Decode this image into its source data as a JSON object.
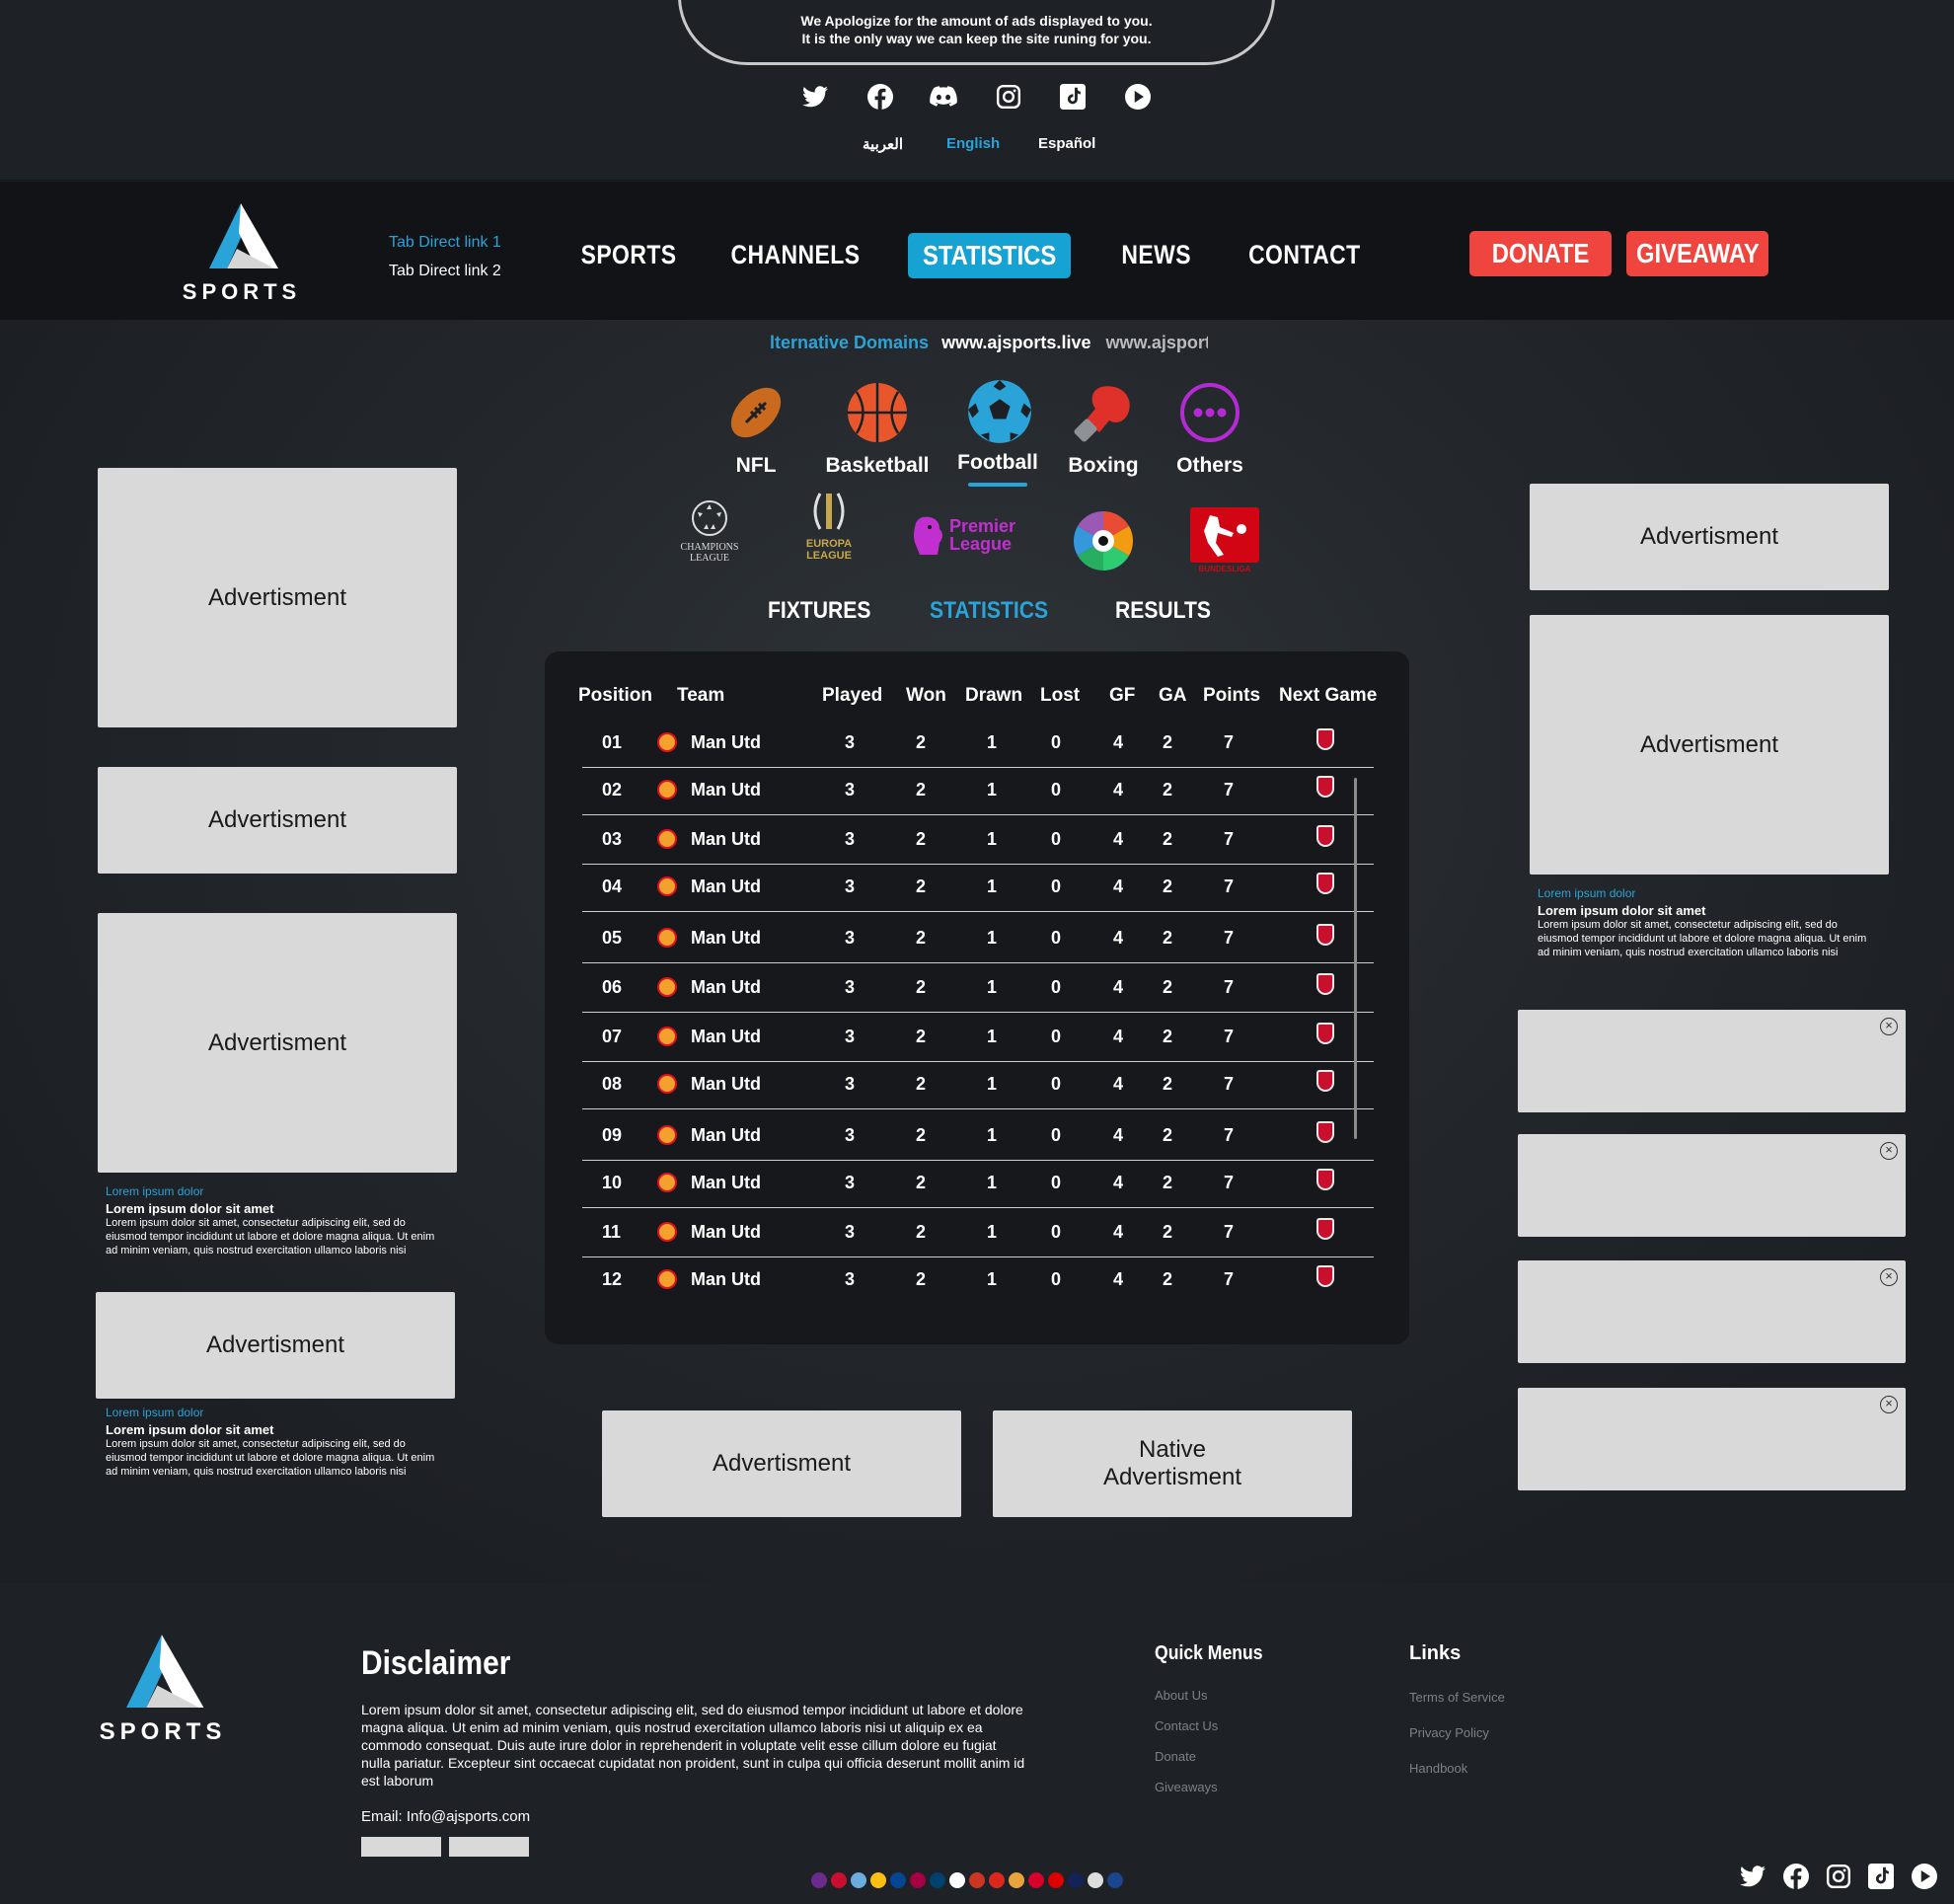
{
  "notice": {
    "line1": "We Apologize for the amount of ads displayed to you.",
    "line2": "It is the only way we can keep the site runing for you."
  },
  "social_icons": [
    "twitter-icon",
    "facebook-icon",
    "discord-icon",
    "instagram-icon",
    "tiktok-icon",
    "play-icon"
  ],
  "languages": {
    "arabic": "العربية",
    "english": "English",
    "spanish": "Español"
  },
  "logo": {
    "text": "SPORTS"
  },
  "tab_links": {
    "link1": "Tab Direct link 1",
    "link2": "Tab Direct link 2"
  },
  "nav": {
    "sports": "SPORTS",
    "channels": "CHANNELS",
    "statistics": "STATISTICS",
    "news": "NEWS",
    "contact": "CONTACT"
  },
  "buttons": {
    "donate": "DONATE",
    "giveaway": "GIVEAWAY"
  },
  "domains": {
    "label": "lternative Domains",
    "d1": "www.ajsports.live",
    "d2": "www.ajsports.liv"
  },
  "sports": [
    {
      "label": "NFL",
      "icon": "football-nfl-icon",
      "color": "#c96a1e"
    },
    {
      "label": "Basketball",
      "icon": "basketball-icon",
      "color": "#e8572c"
    },
    {
      "label": "Football",
      "icon": "soccer-ball-icon",
      "color": "#2aa3d8"
    },
    {
      "label": "Boxing",
      "icon": "boxing-glove-icon",
      "color": "#e0302a"
    },
    {
      "label": "Others",
      "icon": "more-icon",
      "color": "#b62ad6"
    }
  ],
  "leagues": {
    "ucl": "CHAMPIONS LEAGUE",
    "uel": "EUROPA LEAGUE",
    "pl": "Premier League",
    "bundesliga": "BUNDESLIGA"
  },
  "tabs": {
    "fixtures": "FIXTURES",
    "statistics": "STATISTICS",
    "results": "RESULTS"
  },
  "table": {
    "headers": {
      "position": "Position",
      "team": "Team",
      "played": "Played",
      "won": "Won",
      "drawn": "Drawn",
      "lost": "Lost",
      "gf": "GF",
      "ga": "GA",
      "points": "Points",
      "next": "Next Game"
    },
    "rows": [
      {
        "pos": "01",
        "team": "Man Utd",
        "played": "3",
        "won": "2",
        "drawn": "1",
        "lost": "0",
        "gf": "4",
        "ga": "2",
        "points": "7"
      },
      {
        "pos": "02",
        "team": "Man Utd",
        "played": "3",
        "won": "2",
        "drawn": "1",
        "lost": "0",
        "gf": "4",
        "ga": "2",
        "points": "7"
      },
      {
        "pos": "03",
        "team": "Man Utd",
        "played": "3",
        "won": "2",
        "drawn": "1",
        "lost": "0",
        "gf": "4",
        "ga": "2",
        "points": "7"
      },
      {
        "pos": "04",
        "team": "Man Utd",
        "played": "3",
        "won": "2",
        "drawn": "1",
        "lost": "0",
        "gf": "4",
        "ga": "2",
        "points": "7"
      },
      {
        "pos": "05",
        "team": "Man Utd",
        "played": "3",
        "won": "2",
        "drawn": "1",
        "lost": "0",
        "gf": "4",
        "ga": "2",
        "points": "7"
      },
      {
        "pos": "06",
        "team": "Man Utd",
        "played": "3",
        "won": "2",
        "drawn": "1",
        "lost": "0",
        "gf": "4",
        "ga": "2",
        "points": "7"
      },
      {
        "pos": "07",
        "team": "Man Utd",
        "played": "3",
        "won": "2",
        "drawn": "1",
        "lost": "0",
        "gf": "4",
        "ga": "2",
        "points": "7"
      },
      {
        "pos": "08",
        "team": "Man Utd",
        "played": "3",
        "won": "2",
        "drawn": "1",
        "lost": "0",
        "gf": "4",
        "ga": "2",
        "points": "7"
      },
      {
        "pos": "09",
        "team": "Man Utd",
        "played": "3",
        "won": "2",
        "drawn": "1",
        "lost": "0",
        "gf": "4",
        "ga": "2",
        "points": "7"
      },
      {
        "pos": "10",
        "team": "Man Utd",
        "played": "3",
        "won": "2",
        "drawn": "1",
        "lost": "0",
        "gf": "4",
        "ga": "2",
        "points": "7"
      },
      {
        "pos": "11",
        "team": "Man Utd",
        "played": "3",
        "won": "2",
        "drawn": "1",
        "lost": "0",
        "gf": "4",
        "ga": "2",
        "points": "7"
      },
      {
        "pos": "12",
        "team": "Man Utd",
        "played": "3",
        "won": "2",
        "drawn": "1",
        "lost": "0",
        "gf": "4",
        "ga": "2",
        "points": "7"
      }
    ]
  },
  "ads": {
    "label": "Advertisment",
    "native_line1": "Native",
    "native_line2": "Advertisment"
  },
  "ad_caption": {
    "category": "Lorem ipsum dolor",
    "title": "Lorem ipsum dolor sit amet",
    "body": "Lorem ipsum dolor sit amet, consectetur adipiscing elit, sed do eiusmod tempor incididunt ut labore et dolore magna aliqua. Ut enim ad minim veniam, quis nostrud exercitation ullamco laboris nisi"
  },
  "footer": {
    "disclaimer_title": "Disclaimer",
    "disclaimer_text": "Lorem ipsum dolor sit amet, consectetur adipiscing elit, sed do eiusmod tempor incididunt ut labore et dolore magna aliqua. Ut enim ad minim veniam, quis nostrud exercitation ullamco laboris nisi ut aliquip ex ea commodo consequat. Duis aute irure dolor in reprehenderit in voluptate velit esse cillum dolore eu fugiat nulla pariatur. Excepteur sint occaecat cupidatat non proident, sunt in culpa qui officia deserunt mollit anim id est laborum",
    "email": "Email: Info@ajsports.com",
    "quick_title": "Quick Menus",
    "quick": [
      "About Us",
      "Contact Us",
      "Donate",
      "Giveaways"
    ],
    "links_title": "Links",
    "links": [
      "Terms of Service",
      "Privacy Policy",
      "Handbook"
    ]
  },
  "colors": {
    "accent": "#2aa3d8",
    "donate": "#f0443e",
    "bg": "#1c1f23"
  }
}
